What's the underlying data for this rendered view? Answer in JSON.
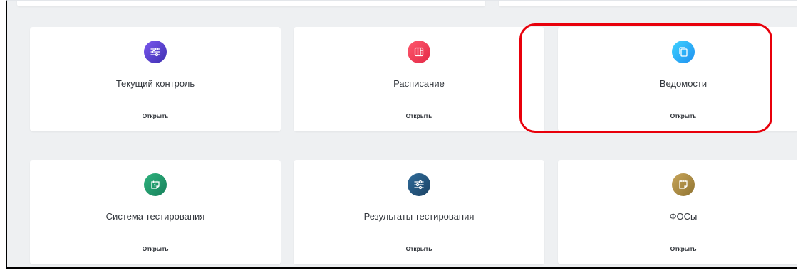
{
  "tiles": [
    {
      "title": "Текущий контроль",
      "open": "Открыть",
      "icon": "sliders-icon",
      "color": "#5b45d8"
    },
    {
      "title": "Расписание",
      "open": "Открыть",
      "icon": "columns-icon",
      "color": "#f03c56"
    },
    {
      "title": "Ведомости",
      "open": "Открыть",
      "icon": "copy-icon",
      "color": "#2fb2f8"
    },
    {
      "title": "Система тестирования",
      "open": "Открыть",
      "icon": "calendar-icon",
      "color": "#23996b"
    },
    {
      "title": "Результаты тестирования",
      "open": "Открыть",
      "icon": "sliders-icon",
      "color": "#265679"
    },
    {
      "title": "ФОСы",
      "open": "Открыть",
      "icon": "notepad-icon",
      "color": "#ab8c45"
    }
  ],
  "highlight_color": "#e8000b"
}
